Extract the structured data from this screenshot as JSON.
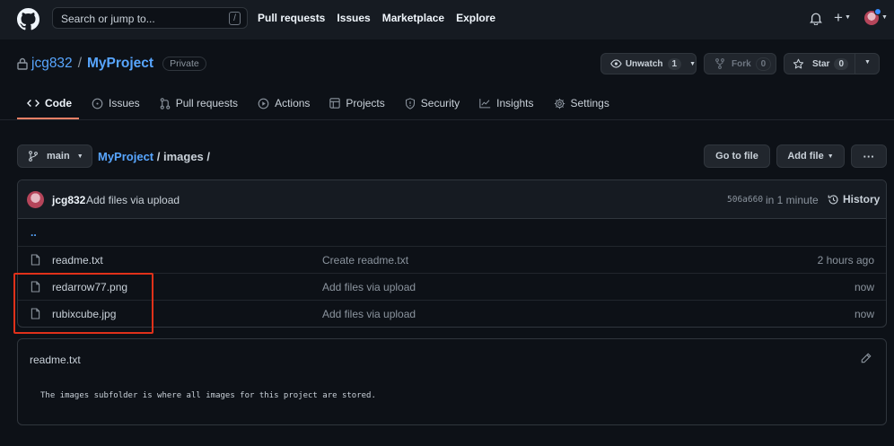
{
  "header": {
    "search_placeholder": "Search or jump to...",
    "search_shortcut": "/",
    "nav": [
      "Pull requests",
      "Issues",
      "Marketplace",
      "Explore"
    ],
    "plus_label": "+"
  },
  "repo": {
    "owner": "jcg832",
    "separator": "/",
    "name": "MyProject",
    "visibility": "Private",
    "unwatch_label": "Unwatch",
    "unwatch_count": "1",
    "fork_label": "Fork",
    "fork_count": "0",
    "star_label": "Star",
    "star_count": "0"
  },
  "tabs": [
    {
      "label": "Code",
      "icon": "code-icon",
      "active": true
    },
    {
      "label": "Issues",
      "icon": "issues-icon"
    },
    {
      "label": "Pull requests",
      "icon": "pull-request-icon"
    },
    {
      "label": "Actions",
      "icon": "play-icon"
    },
    {
      "label": "Projects",
      "icon": "table-icon"
    },
    {
      "label": "Security",
      "icon": "shield-icon"
    },
    {
      "label": "Insights",
      "icon": "graph-icon"
    },
    {
      "label": "Settings",
      "icon": "gear-icon"
    }
  ],
  "branch": {
    "name": "main",
    "crumb_repo": "MyProject",
    "crumb_rest": " / images /",
    "go_to_file": "Go to file",
    "add_file": "Add file",
    "more": "···"
  },
  "commit": {
    "user": "jcg832",
    "message": "Add files via upload",
    "hash": "506a660",
    "time": "in 1 minute",
    "history": "History"
  },
  "files": {
    "updir": "..",
    "rows": [
      {
        "name": "readme.txt",
        "message": "Create readme.txt",
        "age": "2 hours ago"
      },
      {
        "name": "redarrow77.png",
        "message": "Add files via upload",
        "age": "now"
      },
      {
        "name": "rubixcube.jpg",
        "message": "Add files via upload",
        "age": "now"
      }
    ]
  },
  "readme": {
    "title": "readme.txt",
    "body": "The images subfolder is where all images for this project are stored."
  },
  "colors": {
    "background": "#0d1117",
    "header": "#161b22",
    "link": "#58a6ff",
    "active_tab": "#f78166",
    "highlight": "#e0311a"
  }
}
